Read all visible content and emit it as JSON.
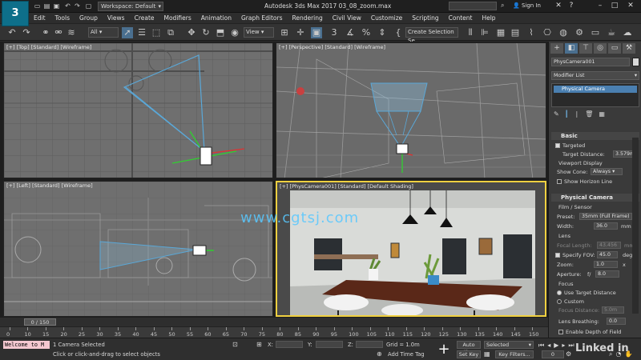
{
  "app": {
    "logo_text": "3",
    "title": "Autodesk 3ds Max 2017     03_08_zoom.max",
    "workspace": "Workspace: Default",
    "sign_in": "Sign In"
  },
  "menu": [
    "Edit",
    "Tools",
    "Group",
    "Views",
    "Create",
    "Modifiers",
    "Animation",
    "Graph Editors",
    "Rendering",
    "Civil View",
    "Customize",
    "Scripting",
    "Content",
    "Help"
  ],
  "toolbar": {
    "filter": "All",
    "ref_coord": "View",
    "selection_set": "Create Selection Se"
  },
  "viewports": {
    "top": "[+] [Top] [Standard] [Wireframe]",
    "perspective": "[+] [Perspective] [Standard] [Wireframe]",
    "left": "[+] [Left] [Standard] [Wireframe]",
    "camera": "[+] [PhysCamera001] [Standard] [Default Shading]"
  },
  "watermark": "www.cgtsj.com",
  "command_panel": {
    "object_name": "PhysCamera001",
    "modifier_list": "Modifier List",
    "stack_item": "Physical Camera",
    "basic": {
      "title": "Basic",
      "targeted": "Targeted",
      "target_distance_label": "Target Distance:",
      "target_distance": "3.579m",
      "viewport_display": "Viewport Display",
      "show_cone_label": "Show Cone:",
      "show_cone": "Always",
      "show_horizon": "Show Horizon Line"
    },
    "physical": {
      "title": "Physical Camera",
      "film_sensor": "Film / Sensor",
      "preset_label": "Preset:",
      "preset": "35mm (Full Frame)",
      "width_label": "Width:",
      "width": "36.0",
      "width_unit": "mm",
      "lens": "Lens",
      "focal_length_label": "Focal Length:",
      "focal_length": "43.456",
      "focal_unit": "mm",
      "specify_fov": "Specify FOV:",
      "fov": "45.0",
      "fov_unit": "deg",
      "zoom_label": "Zoom:",
      "zoom": "1.0",
      "zoom_unit": "x",
      "aperture_label": "Aperture:",
      "aperture_prefix": "f/",
      "aperture": "8.0",
      "focus": "Focus",
      "use_target": "Use Target Distance",
      "custom": "Custom",
      "focus_distance_label": "Focus Distance:",
      "focus_distance": "5.0m",
      "lens_breathing_label": "Lens Breathing:",
      "lens_breathing": "0.0",
      "enable_dof": "Enable Depth of Field"
    }
  },
  "timeline": {
    "frame": "0 / 150",
    "ticks": [
      "0",
      "10",
      "15",
      "20",
      "25",
      "30",
      "35",
      "40",
      "45",
      "50",
      "55",
      "60",
      "65",
      "70",
      "75",
      "80",
      "85",
      "90",
      "95",
      "100",
      "105",
      "110",
      "115",
      "120",
      "125",
      "130",
      "135",
      "140",
      "145",
      "150"
    ]
  },
  "status": {
    "script": "Welcome to M",
    "selection": "1 Camera Selected",
    "prompt": "Click or click-and-drag to select objects",
    "x_label": "X:",
    "y_label": "Y:",
    "z_label": "Z:",
    "grid": "Grid = 1.0m",
    "add_time_tag": "Add Time Tag",
    "auto_key": "Auto Key",
    "set_key": "Set Key",
    "selected": "Selected",
    "key_filters": "Key Filters...",
    "frame_value": "0",
    "linkedin": "Linked in"
  },
  "colors": {
    "accent": "#4a6f8f",
    "camera_active_border": "#f0d040",
    "cone": "#5aa8d8"
  }
}
